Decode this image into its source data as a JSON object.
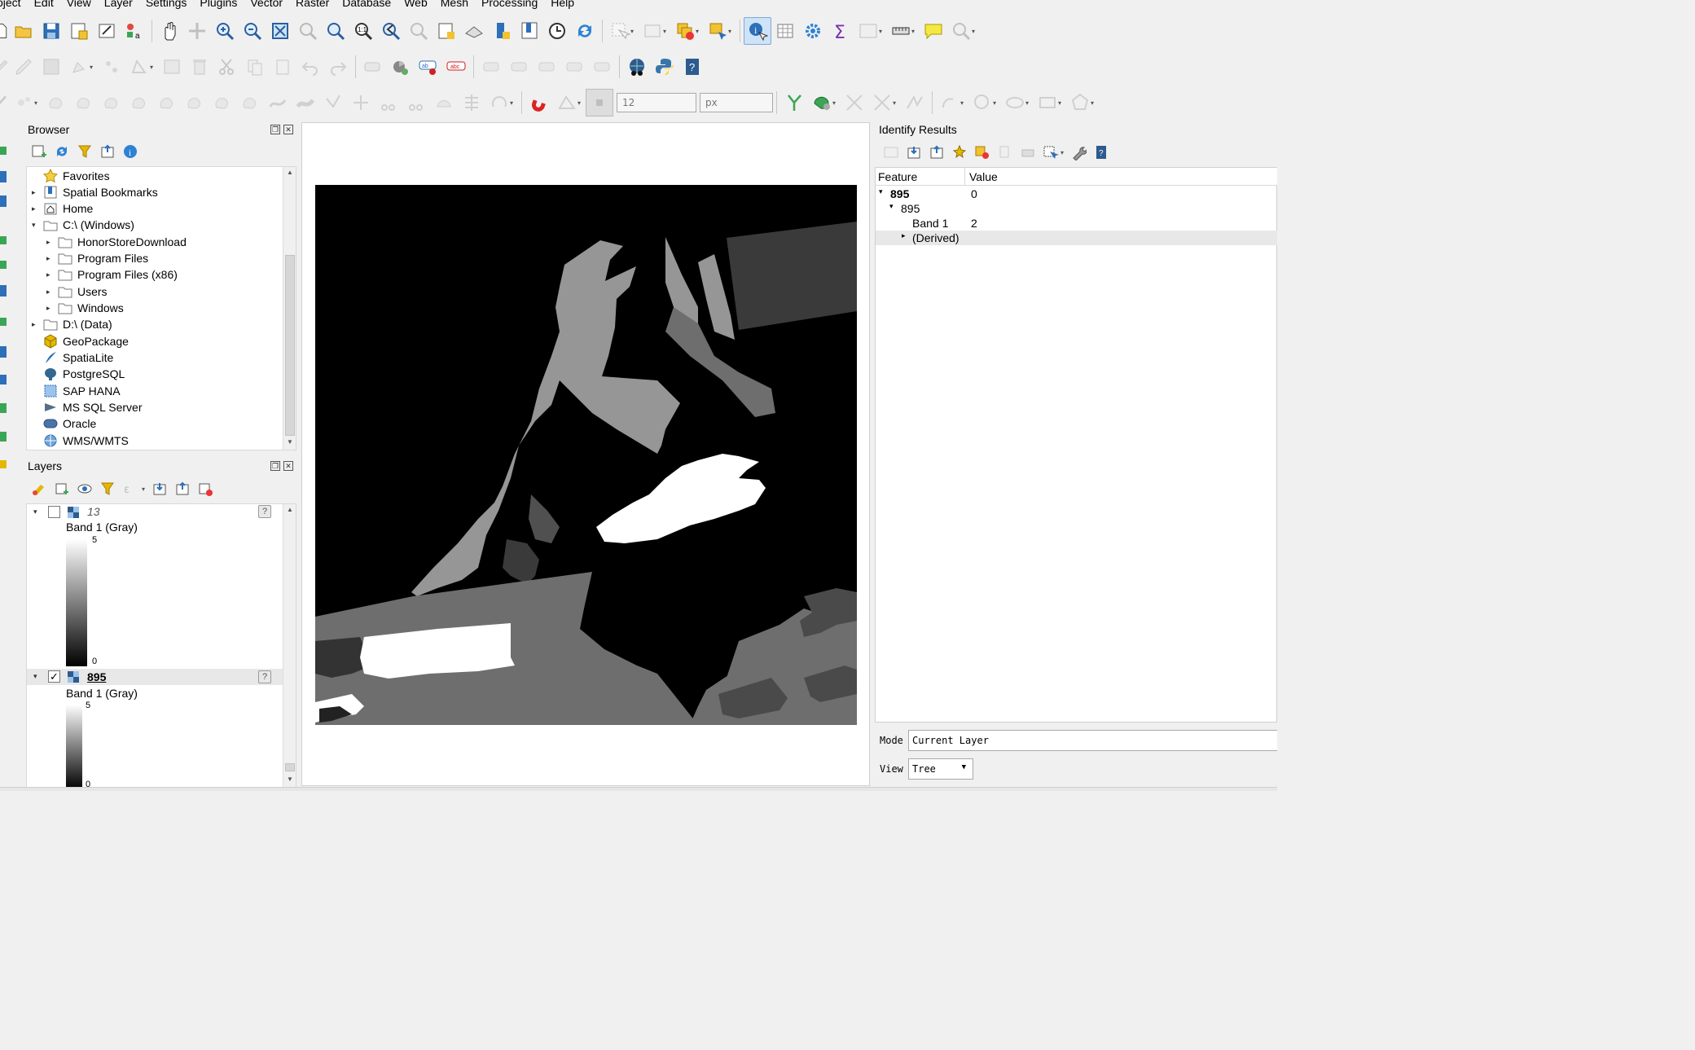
{
  "menu": [
    "oject",
    "Edit",
    "View",
    "Layer",
    "Settings",
    "Plugins",
    "Vector",
    "Raster",
    "Database",
    "Web",
    "Mesh",
    "Processing",
    "Help"
  ],
  "toolbar3": {
    "size_value": "12",
    "unit_value": "px"
  },
  "browser": {
    "title": "Browser",
    "items": [
      {
        "label": "Favorites",
        "icon": "star-icon",
        "arrow": ""
      },
      {
        "label": "Spatial Bookmarks",
        "icon": "bookmark-icon",
        "arrow": "▸"
      },
      {
        "label": "Home",
        "icon": "home-folder-icon",
        "arrow": "▸"
      },
      {
        "label": "C:\\ (Windows)",
        "icon": "drive-icon",
        "arrow": "▾"
      },
      {
        "label": "HonorStoreDownload",
        "icon": "folder-icon",
        "arrow": "▸"
      },
      {
        "label": "Program Files",
        "icon": "folder-icon",
        "arrow": "▸"
      },
      {
        "label": "Program Files (x86)",
        "icon": "folder-icon",
        "arrow": "▸"
      },
      {
        "label": "Users",
        "icon": "folder-icon",
        "arrow": "▸"
      },
      {
        "label": "Windows",
        "icon": "folder-icon",
        "arrow": "▸"
      },
      {
        "label": "D:\\ (Data)",
        "icon": "drive-icon",
        "arrow": "▸"
      },
      {
        "label": "GeoPackage",
        "icon": "geopackage-icon",
        "arrow": ""
      },
      {
        "label": "SpatiaLite",
        "icon": "spatialite-icon",
        "arrow": ""
      },
      {
        "label": "PostgreSQL",
        "icon": "postgresql-icon",
        "arrow": ""
      },
      {
        "label": "SAP HANA",
        "icon": "sap-hana-icon",
        "arrow": ""
      },
      {
        "label": "MS SQL Server",
        "icon": "mssql-icon",
        "arrow": ""
      },
      {
        "label": "Oracle",
        "icon": "oracle-icon",
        "arrow": ""
      },
      {
        "label": "WMS/WMTS",
        "icon": "wms-icon",
        "arrow": ""
      }
    ]
  },
  "layers": {
    "title": "Layers",
    "items": [
      {
        "name": "13",
        "checked": false,
        "band": "Band 1 (Gray)",
        "max": "5",
        "min": "0"
      },
      {
        "name": "895",
        "checked": true,
        "band": "Band 1 (Gray)",
        "max": "5",
        "min": "0"
      }
    ]
  },
  "identify": {
    "title": "Identify Results",
    "col_feature": "Feature",
    "col_value": "Value",
    "rows": [
      {
        "feature": "895",
        "value": "0"
      },
      {
        "feature": "895",
        "value": ""
      },
      {
        "feature": "Band 1",
        "value": "2"
      },
      {
        "feature": "(Derived)",
        "value": ""
      }
    ],
    "mode_label": "Mode",
    "mode_value": "Current Layer",
    "view_label": "View",
    "view_value": "Tree"
  }
}
